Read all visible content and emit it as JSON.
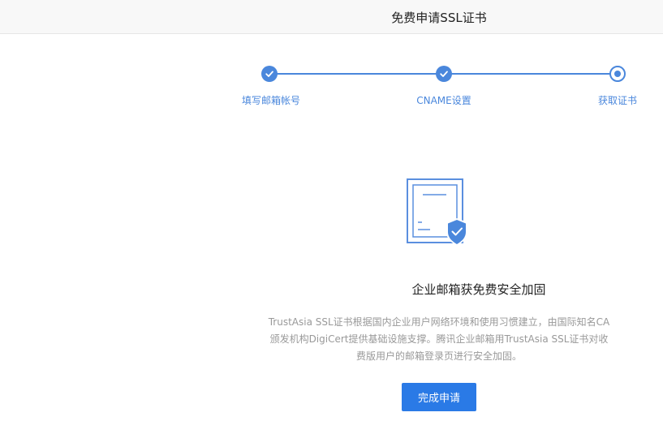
{
  "header": {
    "title": "免费申请SSL证书"
  },
  "steps": [
    {
      "label": "填写邮箱帐号",
      "state": "done"
    },
    {
      "label": "CNAME设置",
      "state": "done"
    },
    {
      "label": "获取证书",
      "state": "current"
    }
  ],
  "illustration": {
    "icon": "certificate-shield-icon"
  },
  "main": {
    "headline": "企业邮箱获免费安全加固",
    "description": "TrustAsia SSL证书根据国内企业用户网络环境和使用习惯建立，由国际知名CA颁发机构DigiCert提供基础设施支撑。腾讯企业邮箱用TrustAsia SSL证书对收费版用户的邮箱登录页进行安全加固。",
    "button_label": "完成申请"
  },
  "colors": {
    "accent": "#4a87dc",
    "button": "#2a7ae6",
    "header_bg": "#f8f8f8"
  }
}
